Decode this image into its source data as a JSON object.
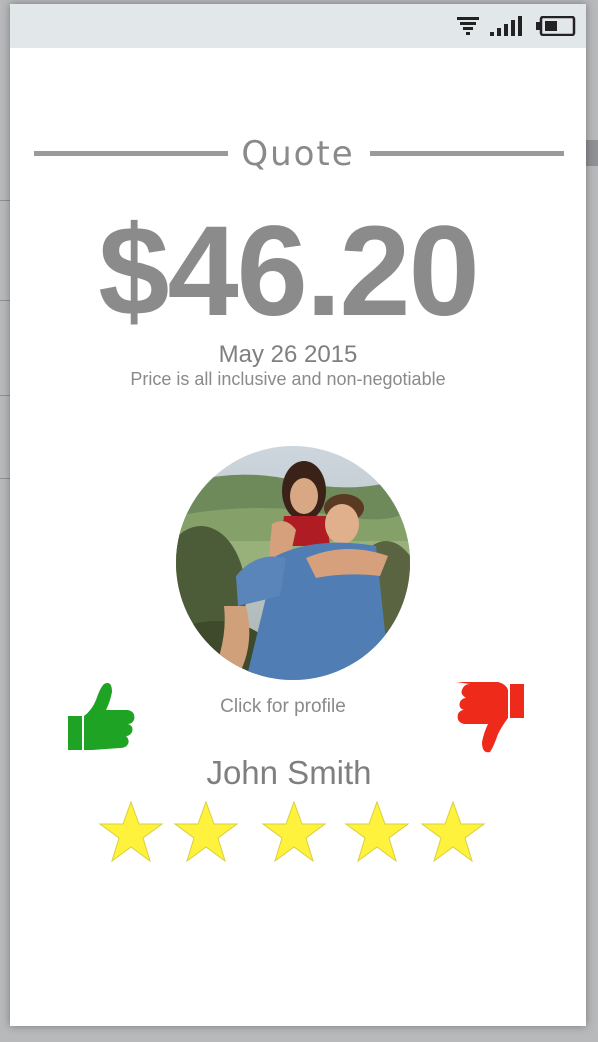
{
  "status_bar": {
    "icons": [
      "wifi-icon",
      "signal-icon",
      "battery-icon"
    ]
  },
  "quote": {
    "title": "Quote",
    "price": "$46.20",
    "date": "May 26 2015",
    "note": "Price is all inclusive and non-negotiable"
  },
  "profile": {
    "photo": "profile-photo",
    "link_label": "Click for profile",
    "name": "John Smith",
    "rating": 5,
    "rating_max": 5
  },
  "actions": {
    "accept_icon": "thumbs-up-icon",
    "decline_icon": "thumbs-down-icon"
  },
  "colors": {
    "accept": "#1fa324",
    "decline": "#ee2a1b",
    "star": "#fff23d",
    "status_bar": "#e2e7ea"
  }
}
